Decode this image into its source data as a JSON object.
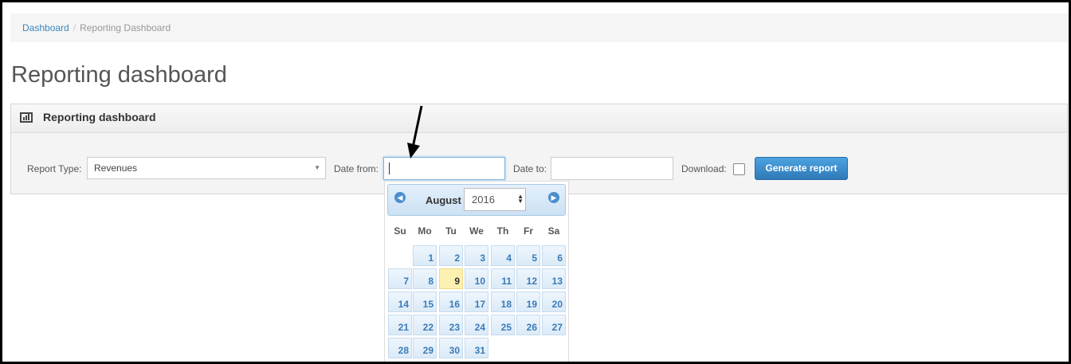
{
  "breadcrumb": {
    "home": "Dashboard",
    "current": "Reporting Dashboard",
    "separator": "/"
  },
  "page_title": "Reporting dashboard",
  "panel": {
    "title": "Reporting dashboard",
    "icon": "bar-chart-icon",
    "report_type_label": "Report Type:",
    "report_type_value": "Revenues",
    "date_from_label": "Date from:",
    "date_from_value": "",
    "date_to_label": "Date to:",
    "date_to_value": "",
    "download_label": "Download:",
    "download_checked": false,
    "generate_button": "Generate report"
  },
  "datepicker": {
    "month": "August",
    "year": "2016",
    "prev_icon": "circle-arrow-left-icon",
    "next_icon": "circle-arrow-right-icon",
    "weekdays": [
      "Su",
      "Mo",
      "Tu",
      "We",
      "Th",
      "Fr",
      "Sa"
    ],
    "first_weekday_index": 1,
    "days_in_month": 31,
    "today": 9
  },
  "colors": {
    "accent": "#3a87c0",
    "button": "#2f79b8",
    "today_highlight": "#fcf1b0"
  }
}
